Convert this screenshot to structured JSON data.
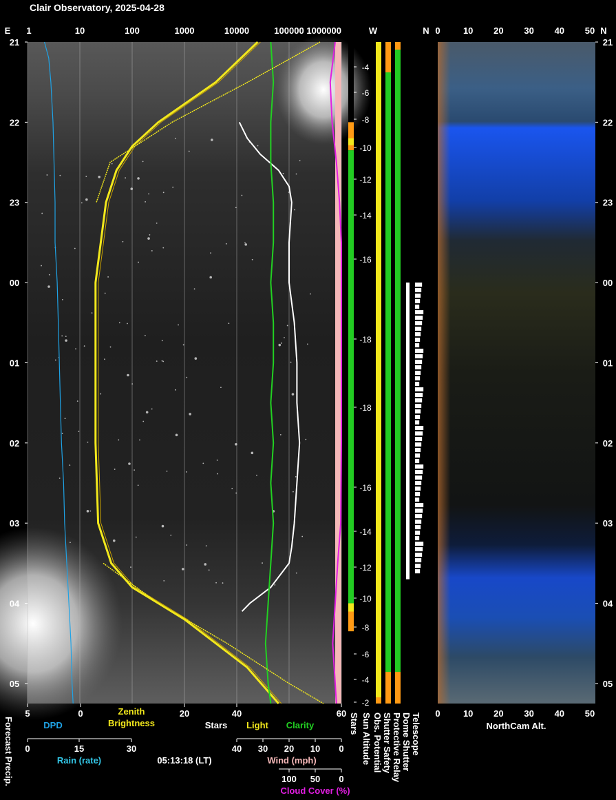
{
  "title": "Clair Observatory, 2025-04-28",
  "colors": {
    "dpd": "#1fa3e6",
    "zenith": "#f2e81c",
    "stars": "#ffffff",
    "light": "#f2e81c",
    "clarity": "#22d022",
    "rain": "#33c6e6",
    "wind": "#f5b8b8",
    "cloud": "#e21ee2",
    "sun_green": "#22cc22",
    "sun_orange": "#ff9a14",
    "bar_yellow": "#f2e81c"
  },
  "chart_data": [
    {
      "type": "line",
      "panel": "allsky",
      "top_axis": {
        "left_label": "E",
        "ticks": [
          "1",
          "10",
          "100",
          "1000",
          "10000",
          "100000",
          "1000000"
        ],
        "scale": "log"
      },
      "right_axis_label": "W",
      "time_ticks": [
        "21",
        "22",
        "23",
        "00",
        "01",
        "02",
        "03",
        "04",
        "05"
      ],
      "time_range_hours": [
        21.0,
        29.25
      ],
      "bottom_axes": [
        {
          "ticks": [
            "5",
            "0",
            "20",
            "40",
            "60"
          ],
          "labels": [
            "DPD",
            "Zenith Brightness",
            "Stars",
            "Light",
            "Clarity"
          ]
        },
        {
          "ticks": [
            "0",
            "15",
            "30"
          ],
          "label": "Rain (rate)"
        },
        {
          "ticks": [
            "40",
            "30",
            "20",
            "10",
            "0"
          ],
          "label": "Wind (mph)"
        },
        {
          "ticks": [
            "100",
            "50",
            "0"
          ],
          "label": "Cloud Cover (%)"
        }
      ],
      "series": [
        {
          "name": "DPD",
          "x_range": [
            -1,
            5
          ],
          "t": [
            21.0,
            21.2,
            21.5,
            22.0,
            22.5,
            23.0,
            23.5,
            24.0,
            24.5,
            25.0,
            25.5,
            26.0,
            26.5,
            27.0,
            27.5,
            28.0,
            28.5,
            29.0,
            29.25
          ],
          "values": [
            3.4,
            3.0,
            2.8,
            2.6,
            2.5,
            2.4,
            2.4,
            2.2,
            2.1,
            2.0,
            1.9,
            1.8,
            1.6,
            1.5,
            1.3,
            1.1,
            0.9,
            0.8,
            0.7
          ]
        },
        {
          "name": "Zenith Brightness",
          "x_range": [
            0,
            60
          ],
          "t": [
            21.0,
            21.5,
            22.0,
            22.3,
            22.6,
            23.0,
            23.5,
            24.0,
            25.0,
            26.0,
            27.0,
            27.5,
            27.8,
            28.0,
            28.2,
            28.5,
            28.8,
            29.25
          ],
          "values": [
            44,
            36,
            25,
            20,
            17,
            15,
            14,
            13,
            13,
            13,
            13.5,
            16,
            20,
            25,
            30,
            36,
            42,
            48
          ]
        },
        {
          "name": "Stars",
          "x_range": [
            20,
            60
          ],
          "t": [
            22.0,
            22.2,
            22.4,
            22.6,
            22.8,
            23.0,
            23.5,
            24.0,
            24.5,
            25.0,
            25.5,
            26.0,
            26.5,
            27.0,
            27.3,
            27.5,
            27.8,
            28.0,
            28.1
          ],
          "values": [
            21,
            24,
            29,
            36,
            40,
            41,
            40,
            40,
            42,
            43,
            43,
            44,
            43,
            42,
            41,
            40,
            33,
            25,
            22
          ]
        },
        {
          "name": "Clarity",
          "x_range": [
            0,
            60
          ],
          "t": [
            21.0,
            21.5,
            22.0,
            22.5,
            23.0,
            23.5,
            24.0,
            24.5,
            25.0,
            25.5,
            26.0,
            26.5,
            27.0,
            27.5,
            28.0,
            28.5,
            29.0,
            29.25
          ],
          "values": [
            33,
            34,
            33,
            33,
            34,
            34,
            33,
            34,
            34,
            33,
            34,
            33,
            34,
            33,
            32,
            31,
            32,
            33
          ]
        },
        {
          "name": "Cloud Cover (%)",
          "x_range": [
            100,
            0
          ],
          "t": [
            21.0,
            21.5,
            22.0,
            22.5,
            23.0,
            23.5,
            24.0,
            25.0,
            26.0,
            27.0,
            27.5,
            28.0,
            28.5,
            29.0,
            29.25
          ],
          "values": [
            10,
            18,
            15,
            8,
            3,
            0,
            0,
            0,
            0,
            1,
            6,
            10,
            14,
            10,
            8
          ]
        }
      ]
    },
    {
      "type": "bar",
      "panel": "sun_altitude",
      "ticks_labels": [
        "-4",
        "-6",
        "-8",
        "-10",
        "-12",
        "-14",
        "-16",
        "-18",
        "-18",
        "-16",
        "-14",
        "-12",
        "-10",
        "-8",
        "-6",
        "-4",
        "-2"
      ],
      "phases": [
        {
          "t0": 21.0,
          "t1": 22.0,
          "state": "day"
        },
        {
          "t0": 22.0,
          "t1": 22.35,
          "state": "twilight"
        },
        {
          "t0": 22.35,
          "t1": 28.0,
          "state": "night"
        },
        {
          "t0": 28.0,
          "t1": 28.35,
          "state": "twilight"
        },
        {
          "t0": 28.35,
          "t1": 29.25,
          "state": "day"
        }
      ]
    },
    {
      "type": "table",
      "panel": "status",
      "labels": [
        "Forecast Precip.",
        "Stars",
        "Sun Altitude",
        "Obs. Potential",
        "Shutter Safety",
        "Protective Relay",
        "Dome Shutter",
        "Telescope"
      ],
      "telescope_active_hours": [
        24.0,
        27.6
      ]
    },
    {
      "type": "heatmap",
      "panel": "northcam",
      "top_axis": {
        "left_label": "N",
        "ticks": [
          "0",
          "10",
          "20",
          "30",
          "40",
          "50"
        ],
        "right_label": "N"
      },
      "bottom_axis": {
        "ticks": [
          "0",
          "10",
          "20",
          "30",
          "40",
          "50"
        ],
        "label": "NorthCam Alt."
      }
    }
  ],
  "timestamp": "05:13:18 (LT)"
}
